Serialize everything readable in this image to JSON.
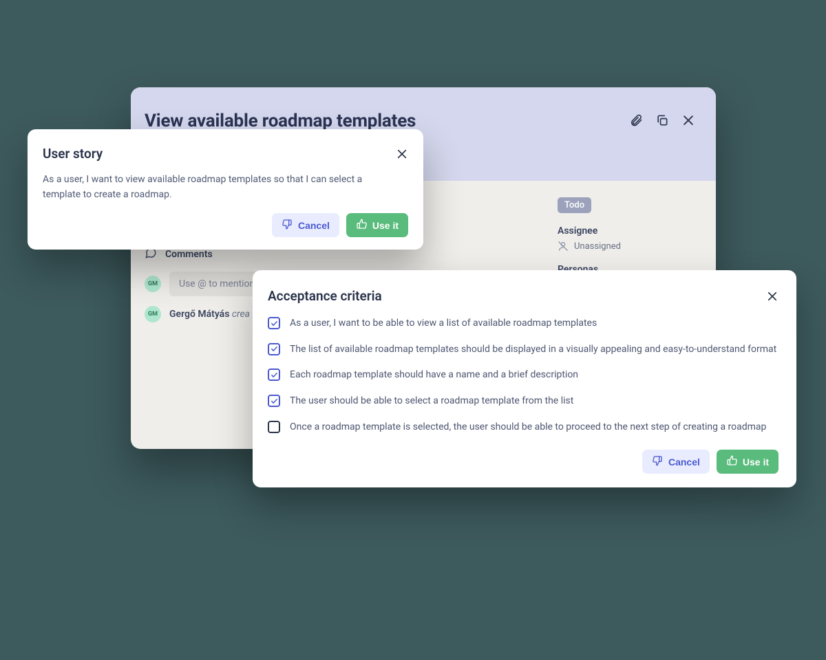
{
  "main": {
    "title": "View available roadmap templates",
    "status": "Todo",
    "assignee_label": "Assignee",
    "assignee_value": "Unassigned",
    "personas_label": "Personas"
  },
  "comments": {
    "heading": "Comments",
    "placeholder": "Use @ to mention",
    "avatar_initials": "GM",
    "author_name": "Gergő Mátyás",
    "author_action": "crea"
  },
  "story": {
    "title": "User story",
    "body": "As a user, I want to view available roadmap templates so that I can select a template to create a roadmap.",
    "cancel": "Cancel",
    "use": "Use it"
  },
  "ac": {
    "title": "Acceptance criteria",
    "items": [
      {
        "checked": true,
        "text": "As a user, I want to be able to view a list of available roadmap templates"
      },
      {
        "checked": true,
        "text": "The list of available roadmap templates should be displayed in a visually appealing and easy-to-understand format"
      },
      {
        "checked": true,
        "text": "Each roadmap template should have a name and a brief description"
      },
      {
        "checked": true,
        "text": "The user should be able to select a roadmap template from the list"
      },
      {
        "checked": false,
        "text": "Once a roadmap template is selected, the user should be able to proceed to the next step of creating a roadmap"
      }
    ],
    "cancel": "Cancel",
    "use": "Use it"
  }
}
